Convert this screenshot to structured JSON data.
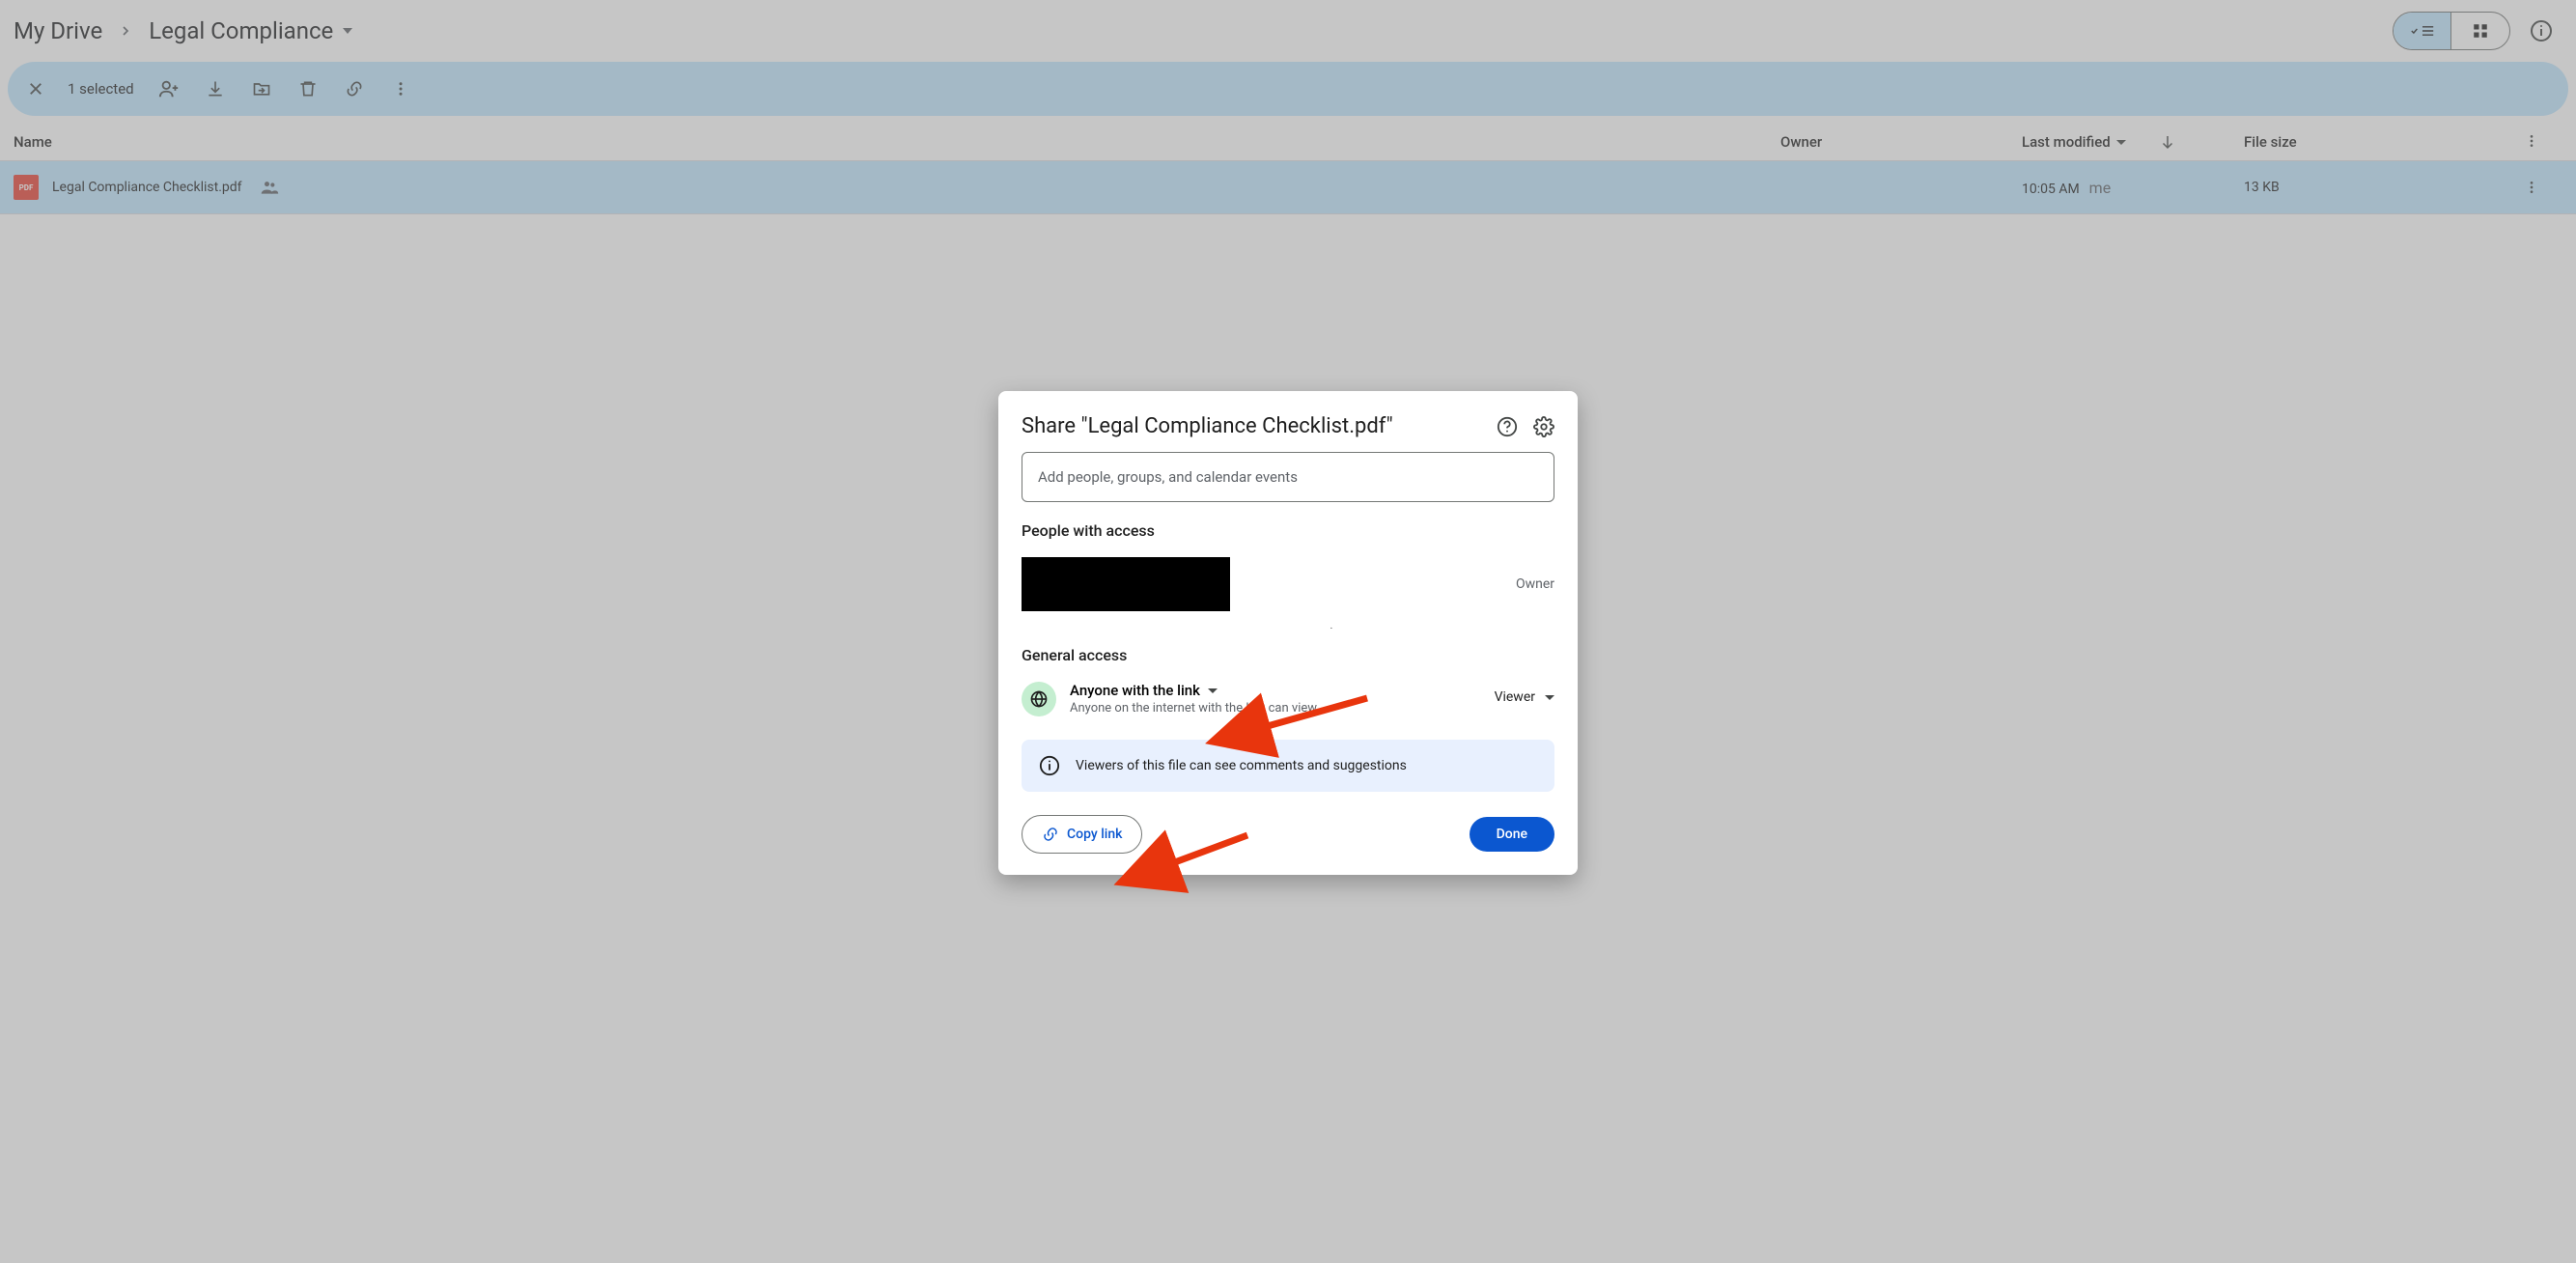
{
  "breadcrumb": {
    "root": "My Drive",
    "current": "Legal Compliance"
  },
  "selection": {
    "text": "1 selected"
  },
  "columns": {
    "name": "Name",
    "owner": "Owner",
    "modified": "Last modified",
    "size": "File size"
  },
  "file": {
    "name": "Legal Compliance Checklist.pdf",
    "modified_time": "10:05 AM",
    "modified_by": "me",
    "size": "13 KB"
  },
  "dialog": {
    "title": "Share \"Legal Compliance Checklist.pdf\"",
    "people_placeholder": "Add people, groups, and calendar events",
    "people_with_access": "People with access",
    "owner_role": "Owner",
    "general_access": "General access",
    "access_scope": "Anyone with the link",
    "access_desc": "Anyone on the internet with the link can view",
    "role": "Viewer",
    "notice": "Viewers of this file can see comments and suggestions",
    "copy_link": "Copy link",
    "done": "Done"
  }
}
